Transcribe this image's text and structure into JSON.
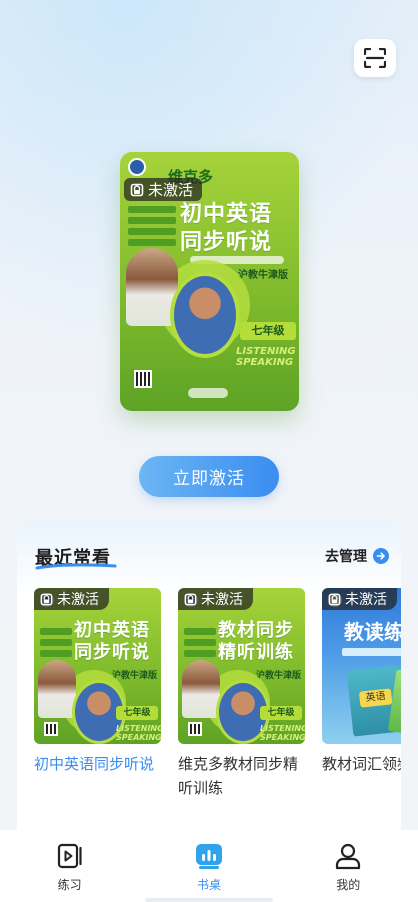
{
  "scan_button": {
    "icon": "scan-icon"
  },
  "featured_book": {
    "cover_title_top": "维克多",
    "cover_title_main_1": "初中英语",
    "cover_title_main_2": "同步听说",
    "cover_edition": "沪教牛津版",
    "cover_grade": "七年级",
    "cover_listening": "LISTENING",
    "cover_speaking": "SPEAKING",
    "status_label": "未激活",
    "status_icon": "lock-icon"
  },
  "activate_button": {
    "label": "立即激活"
  },
  "recent": {
    "title": "最近常看",
    "manage_label": "去管理",
    "books": [
      {
        "name": "初中英语同步听说",
        "status": "未激活",
        "cover_title_1": "初中英语",
        "cover_title_2": "同步听说",
        "cover_edition": "沪教牛津版",
        "cover_grade": "七年级",
        "cover_listening": "LISTENING",
        "cover_speaking": "SPEAKING",
        "active": true
      },
      {
        "name": "维克多教材同步精听训练",
        "status": "未激活",
        "cover_title_1": "教材同步",
        "cover_title_2": "精听训练",
        "cover_edition": "沪教牛津版",
        "cover_grade": "七年级",
        "cover_listening": "LISTENING",
        "cover_speaking": "SPEAKING",
        "active": false
      },
      {
        "name": "教材词汇领频",
        "status": "未激活",
        "cover_title_1": "教读练",
        "cover_subject": "英语",
        "active": false
      }
    ]
  },
  "tabbar": {
    "items": [
      {
        "label": "练习",
        "icon": "video-practice-icon",
        "active": false
      },
      {
        "label": "书桌",
        "icon": "bookshelf-chart-icon",
        "active": true
      },
      {
        "label": "我的",
        "icon": "user-profile-icon",
        "active": false
      }
    ]
  },
  "colors": {
    "accent_blue": "#3a8df0",
    "cover_green": "#8cc63f",
    "inactive_tag_bg": "#333333"
  }
}
